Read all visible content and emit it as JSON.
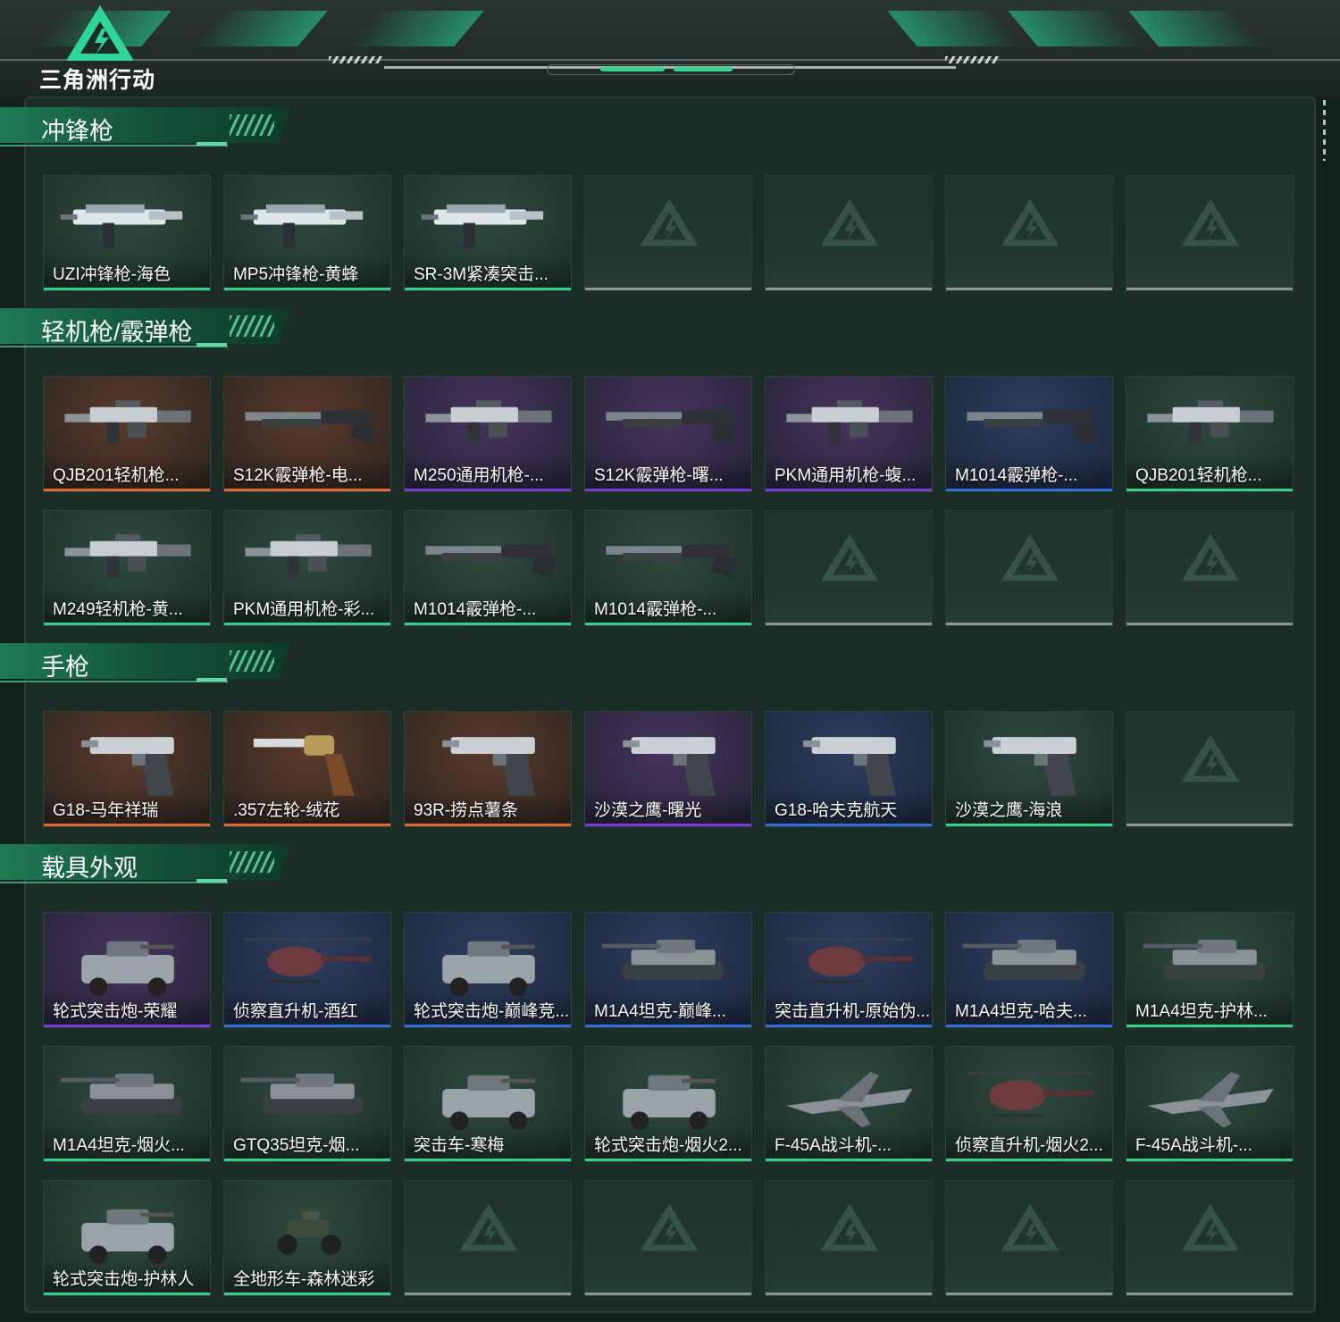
{
  "app": {
    "title": "三角洲行动",
    "colors": {
      "accent": "#2ed48f",
      "panel_bg": "#1b2d26",
      "rarity_orange": "#e06a2a",
      "rarity_purple": "#7a3bd9",
      "rarity_blue": "#2f6fe0",
      "rarity_green": "#35d08e",
      "empty_slot": "#8d9693"
    }
  },
  "sections": [
    {
      "title": "冲锋枪",
      "slots": 7,
      "items": [
        {
          "name": "UZI冲锋枪-海色",
          "rarity": "green",
          "icon": "smg"
        },
        {
          "name": "MP5冲锋枪-黄蜂",
          "rarity": "green",
          "icon": "smg"
        },
        {
          "name": "SR-3M紧凑突击...",
          "rarity": "green",
          "icon": "smg"
        }
      ]
    },
    {
      "title": "轻机枪/霰弹枪",
      "slots": 14,
      "items": [
        {
          "name": "QJB201轻机枪...",
          "rarity": "orange",
          "icon": "lmg"
        },
        {
          "name": "S12K霰弹枪-电...",
          "rarity": "orange",
          "icon": "shotgun"
        },
        {
          "name": "M250通用机枪-...",
          "rarity": "purple",
          "icon": "lmg"
        },
        {
          "name": "S12K霰弹枪-曙...",
          "rarity": "purple",
          "icon": "shotgun"
        },
        {
          "name": "PKM通用机枪-蝮...",
          "rarity": "purple",
          "icon": "lmg"
        },
        {
          "name": "M1014霰弹枪-...",
          "rarity": "blue",
          "icon": "shotgun"
        },
        {
          "name": "QJB201轻机枪...",
          "rarity": "green",
          "icon": "lmg"
        },
        {
          "name": "M249轻机枪-黄...",
          "rarity": "green",
          "icon": "lmg"
        },
        {
          "name": "PKM通用机枪-彩...",
          "rarity": "green",
          "icon": "lmg"
        },
        {
          "name": "M1014霰弹枪-...",
          "rarity": "green",
          "icon": "shotgun"
        },
        {
          "name": "M1014霰弹枪-...",
          "rarity": "green",
          "icon": "shotgun"
        }
      ]
    },
    {
      "title": "手枪",
      "slots": 7,
      "items": [
        {
          "name": "G18-马年祥瑞",
          "rarity": "orange",
          "icon": "pistol"
        },
        {
          "name": ".357左轮-绒花",
          "rarity": "orange",
          "icon": "revolver"
        },
        {
          "name": "93R-捞点薯条",
          "rarity": "orange",
          "icon": "pistol"
        },
        {
          "name": "沙漠之鹰-曙光",
          "rarity": "purple",
          "icon": "pistol"
        },
        {
          "name": "G18-哈夫克航天",
          "rarity": "blue",
          "icon": "pistol"
        },
        {
          "name": "沙漠之鹰-海浪",
          "rarity": "green",
          "icon": "pistol"
        }
      ]
    },
    {
      "title": "载具外观",
      "slots": 21,
      "items": [
        {
          "name": "轮式突击炮-荣耀",
          "rarity": "purple",
          "icon": "armored-car"
        },
        {
          "name": "侦察直升机-酒红",
          "rarity": "blue",
          "icon": "helicopter"
        },
        {
          "name": "轮式突击炮-巅峰竞...",
          "rarity": "blue",
          "icon": "armored-car"
        },
        {
          "name": "M1A4坦克-巅峰...",
          "rarity": "blue",
          "icon": "tank"
        },
        {
          "name": "突击直升机-原始伪...",
          "rarity": "blue",
          "icon": "helicopter"
        },
        {
          "name": "M1A4坦克-哈夫...",
          "rarity": "blue",
          "icon": "tank"
        },
        {
          "name": "M1A4坦克-护林...",
          "rarity": "green",
          "icon": "tank"
        },
        {
          "name": "M1A4坦克-烟火...",
          "rarity": "green",
          "icon": "tank"
        },
        {
          "name": "GTQ35坦克-烟...",
          "rarity": "green",
          "icon": "tank"
        },
        {
          "name": "突击车-寒梅",
          "rarity": "green",
          "icon": "armored-car"
        },
        {
          "name": "轮式突击炮-烟火2...",
          "rarity": "green",
          "icon": "armored-car"
        },
        {
          "name": "F-45A战斗机-...",
          "rarity": "green",
          "icon": "jet"
        },
        {
          "name": "侦察直升机-烟火2...",
          "rarity": "green",
          "icon": "helicopter"
        },
        {
          "name": "F-45A战斗机-...",
          "rarity": "green",
          "icon": "jet"
        },
        {
          "name": "轮式突击炮-护林人",
          "rarity": "green",
          "icon": "armored-car"
        },
        {
          "name": "全地形车-森林迷彩",
          "rarity": "green",
          "icon": "atv"
        }
      ]
    }
  ]
}
